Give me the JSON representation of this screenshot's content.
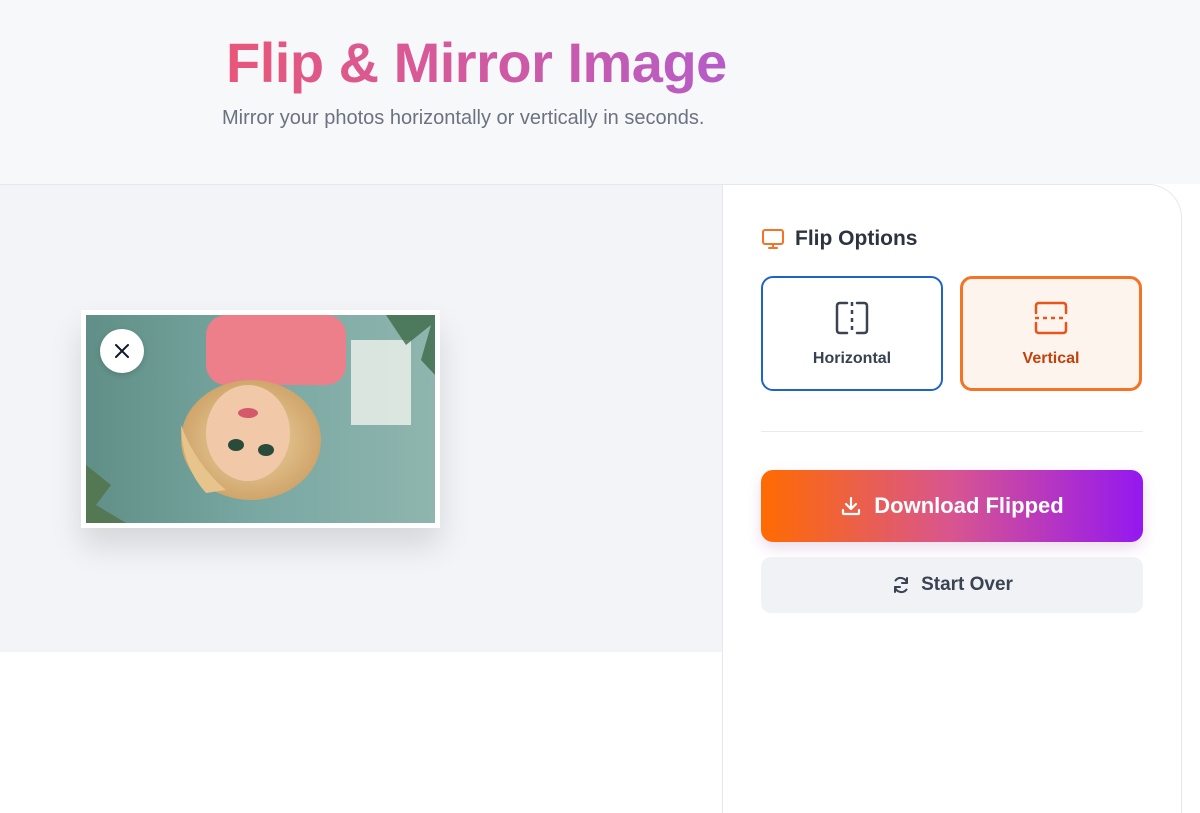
{
  "header": {
    "title": "Flip & Mirror Image",
    "subtitle": "Mirror your photos horizontally or vertically in seconds."
  },
  "preview": {
    "remove_icon": "close-icon",
    "flip_applied": "vertical"
  },
  "panel": {
    "section_title": "Flip Options",
    "section_icon": "monitor-icon",
    "options": [
      {
        "label": "Horizontal",
        "icon": "flip-horizontal-icon",
        "selected": false
      },
      {
        "label": "Vertical",
        "icon": "flip-vertical-icon",
        "selected": true
      }
    ],
    "download_label": "Download Flipped",
    "download_icon": "download-icon",
    "startover_label": "Start Over",
    "startover_icon": "refresh-icon"
  },
  "colors": {
    "accent_orange": "#f47325",
    "accent_blue": "#1d64c4",
    "gradient_start": "#ff6b00",
    "gradient_end": "#9418f0"
  }
}
